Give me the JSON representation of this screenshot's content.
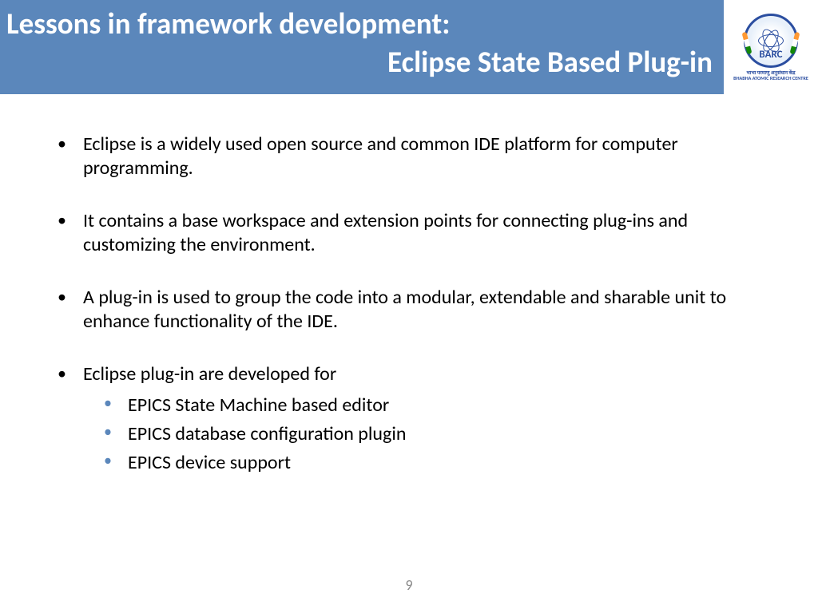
{
  "header": {
    "title_line1": "Lessons in framework development:",
    "title_line2": "Eclipse State Based Plug-in"
  },
  "logo": {
    "acronym": "BARC",
    "org_line1": "भाभा परमाणु अनुसंधान केंद्र",
    "org_line2": "BHABHA ATOMIC RESEARCH CENTRE"
  },
  "bullets": [
    "Eclipse is a widely used open source and common IDE platform for computer programming.",
    "It contains a base workspace and extension points for connecting plug-ins and customizing the environment.",
    "A plug-in is used to group the code into a modular, extendable and sharable unit to enhance functionality of the IDE.",
    "Eclipse plug-in are developed for"
  ],
  "sub_bullets": [
    "EPICS State Machine based editor",
    "EPICS database configuration plugin",
    "EPICS device support"
  ],
  "page_number": "9"
}
